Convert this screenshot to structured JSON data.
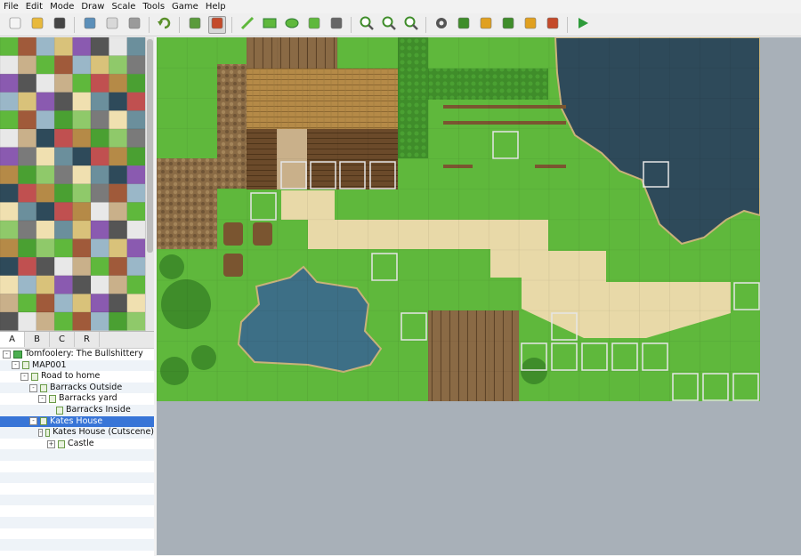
{
  "menu": [
    "File",
    "Edit",
    "Mode",
    "Draw",
    "Scale",
    "Tools",
    "Game",
    "Help"
  ],
  "toolbar": {
    "buttons": [
      {
        "name": "new-project-icon"
      },
      {
        "name": "open-project-icon"
      },
      {
        "name": "save-project-icon"
      },
      {
        "sep": true
      },
      {
        "name": "cut-icon"
      },
      {
        "name": "copy-icon"
      },
      {
        "name": "paste-icon"
      },
      {
        "sep": true
      },
      {
        "name": "undo-icon"
      },
      {
        "sep": true
      },
      {
        "name": "map-mode-icon"
      },
      {
        "name": "event-mode-icon",
        "active": true
      },
      {
        "sep": true
      },
      {
        "name": "pencil-icon"
      },
      {
        "name": "rectangle-icon"
      },
      {
        "name": "ellipse-icon"
      },
      {
        "name": "fill-icon"
      },
      {
        "name": "shadow-pen-icon"
      },
      {
        "sep": true
      },
      {
        "name": "zoom-in-icon"
      },
      {
        "name": "zoom-out-icon"
      },
      {
        "name": "zoom-actual-icon"
      },
      {
        "sep": true
      },
      {
        "name": "database-icon"
      },
      {
        "name": "plugin-manager-icon"
      },
      {
        "name": "sound-test-icon"
      },
      {
        "name": "event-searcher-icon"
      },
      {
        "name": "resource-manager-icon"
      },
      {
        "name": "character-generator-icon"
      },
      {
        "sep": true
      },
      {
        "name": "playtest-icon"
      }
    ]
  },
  "tileset_tabs": [
    "A",
    "B",
    "C",
    "R"
  ],
  "selected_tab": "A",
  "map_tree": [
    {
      "label": "Tomfoolery: The Bullshittery",
      "depth": 0,
      "type": "project",
      "expander": "-"
    },
    {
      "label": "MAP001",
      "depth": 1,
      "type": "map",
      "expander": "-"
    },
    {
      "label": "Road to home",
      "depth": 2,
      "type": "map",
      "expander": "-"
    },
    {
      "label": "Barracks Outside",
      "depth": 3,
      "type": "map",
      "expander": "-"
    },
    {
      "label": "Barracks yard",
      "depth": 4,
      "type": "map",
      "expander": "-"
    },
    {
      "label": "Barracks Inside",
      "depth": 5,
      "type": "map",
      "expander": ""
    },
    {
      "label": "Kates House",
      "depth": 3,
      "type": "map",
      "expander": "-",
      "selected": true
    },
    {
      "label": "Kates House (Cutscene)",
      "depth": 4,
      "type": "map",
      "expander": "-"
    },
    {
      "label": "Castle",
      "depth": 5,
      "type": "map",
      "expander": "+"
    }
  ],
  "colors": {
    "grass": "#5fb83c",
    "grass_dark": "#4f9e30",
    "water": "#2e4a5a",
    "shallow": "#3d6f86",
    "path": "#e8d9a8",
    "roof": "#b58a47",
    "wood": "#6b4a2a",
    "cliff": "#8a6b45",
    "hedge": "#3f8d2a",
    "selection": "#3875d7",
    "canvas_bg": "#a8b0b8"
  }
}
